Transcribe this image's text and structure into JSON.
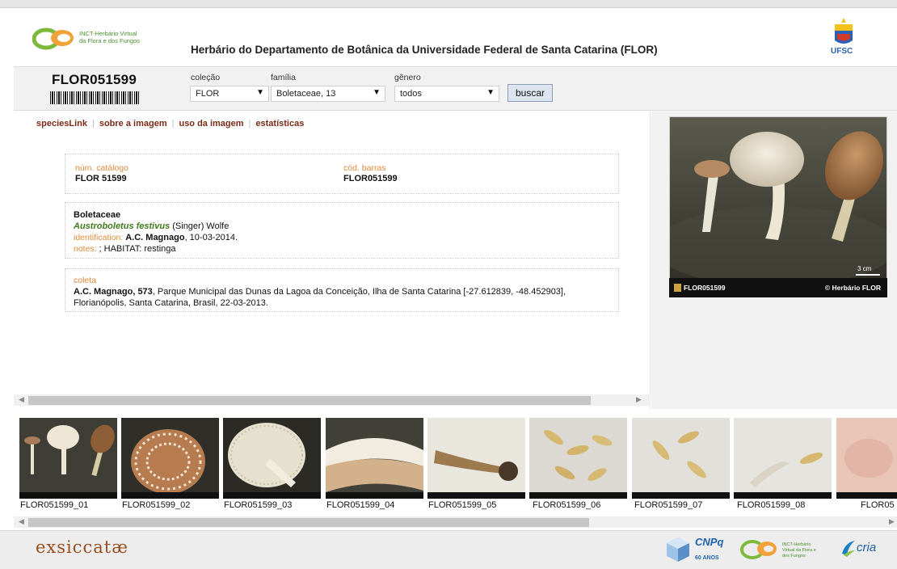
{
  "header": {
    "logo_text_line1": "INCT-Herbário Virtual",
    "logo_text_line2": "da Flora e dos Fungos",
    "title": "Herbário do Departamento de Botânica da Universidade Federal de Santa Catarina (FLOR)",
    "ufsc_logo_text": "UFSC"
  },
  "toolbar": {
    "catalog_id": "FLOR051599",
    "colecao_label": "coleção",
    "colecao_value": "FLOR",
    "familia_label": "família",
    "familia_value": "Boletaceae, 13",
    "genero_label": "gênero",
    "genero_value": "todos",
    "search_button": "buscar"
  },
  "nav": {
    "items": [
      "speciesLink",
      "sobre a imagem",
      "uso da imagem",
      "estatísticas"
    ]
  },
  "record": {
    "catalog_label": "núm. catálogo",
    "catalog_value": "FLOR 51599",
    "barcode_label": "cód. barras",
    "barcode_value": "FLOR051599",
    "family": "Boletaceae",
    "species": "Austroboletus festivus",
    "author": " (Singer) Wolfe",
    "identification_label": "identification: ",
    "identification_person": "A.C. Magnago",
    "identification_date": ", 10-03-2014.",
    "notes_label": "notes: ",
    "notes_value": "; HABITAT: restinga",
    "coleta_label": "coleta",
    "coleta_collector": "A.C. Magnago, 573",
    "coleta_text": ", Parque Municipal das Dunas da Lagoa da Conceição, Ilha de Santa Catarina [-27.612839, -48.452903], Florianópolis, Santa Catarina, Brasil, 22-03-2013."
  },
  "photo": {
    "id_caption": "FLOR051599",
    "copyright": "© Herbário FLOR",
    "scale": "3 cm"
  },
  "thumbnails": [
    {
      "label": "FLOR051599_01",
      "kind": "mushrooms"
    },
    {
      "label": "FLOR051599_02",
      "kind": "cap-top"
    },
    {
      "label": "FLOR051599_03",
      "kind": "cap-under"
    },
    {
      "label": "FLOR051599_04",
      "kind": "section"
    },
    {
      "label": "FLOR051599_05",
      "kind": "stipe-base"
    },
    {
      "label": "FLOR051599_06",
      "kind": "spores"
    },
    {
      "label": "FLOR051599_07",
      "kind": "spores"
    },
    {
      "label": "FLOR051599_08",
      "kind": "spores-basidia"
    },
    {
      "label": "FLOR05",
      "kind": "tissue"
    }
  ],
  "footer": {
    "brand": "exsiccatæ",
    "cnpq_text": "CNPq",
    "cnpq_years": "60 ANOS",
    "inct_text": "INCT-Herbário Virtual da Flora e dos Fungos",
    "cria_text": "cria"
  },
  "colors": {
    "link": "#7a2b18",
    "label_orange": "#e08a3c",
    "species_green": "#3f7a1c",
    "brand_brown": "#9a4d1e"
  }
}
